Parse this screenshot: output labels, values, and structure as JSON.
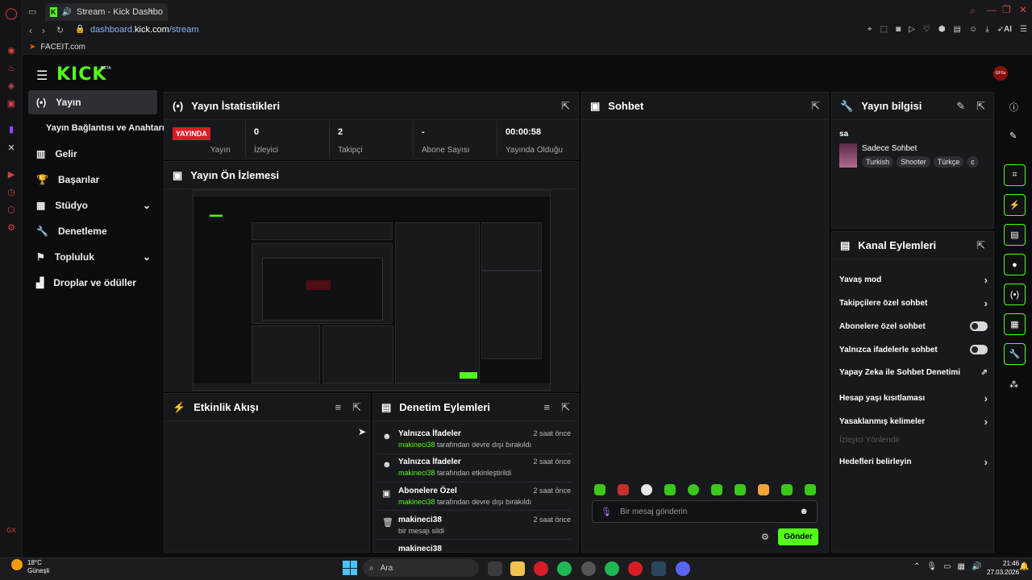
{
  "browser": {
    "tab_title": "Stream - Kick Dashbo",
    "url_host": "dashboard.",
    "url_domain": "kick.com",
    "url_path": "/stream",
    "bookmark": "FACEIT.com",
    "ai_label": "AI"
  },
  "header": {
    "logo": "KICK",
    "beta": "BETA",
    "avatar": "GFSs"
  },
  "sidebar": {
    "items": [
      {
        "label": "Yayın",
        "icon": "broadcast-icon"
      },
      {
        "label": "Yayın Bağlantısı ve Anahtarı",
        "icon": ""
      },
      {
        "label": "Gelir",
        "icon": "bar-chart-icon"
      },
      {
        "label": "Başarılar",
        "icon": "trophy-icon"
      },
      {
        "label": "Stüdyo",
        "icon": "studio-icon"
      },
      {
        "label": "Denetleme",
        "icon": "wrench-icon"
      },
      {
        "label": "Topluluk",
        "icon": "community-icon"
      },
      {
        "label": "Droplar ve ödüller",
        "icon": "gift-icon"
      }
    ]
  },
  "stats": {
    "title": "Yayın İstatistikleri",
    "live_badge": "YAYINDA",
    "live_label": "Yayın",
    "items": [
      {
        "value": "0",
        "label": "İzleyici"
      },
      {
        "value": "2",
        "label": "Takipçi"
      },
      {
        "value": "-",
        "label": "Abone Sayısı"
      },
      {
        "value": "00:00:58",
        "label": "Yayında Olduğu"
      }
    ]
  },
  "preview": {
    "title": "Yayın Ön İzlemesi"
  },
  "activity": {
    "title": "Etkinlik Akışı"
  },
  "moderation": {
    "title": "Denetim Eylemleri",
    "items": [
      {
        "title": "Yalnızca İfadeler",
        "user": "makineci38",
        "text": " tarafından devre dışı bırakıldı",
        "time": "2 saat önce"
      },
      {
        "title": "Yalnızca İfadeler",
        "user": "makineci38",
        "text": " tarafından etkinleştirildi",
        "time": "2 saat önce"
      },
      {
        "title": "Abonelere Özel",
        "user": "makineci38",
        "text": " tarafından devre dışı bırakıldı",
        "time": "2 saat önce"
      },
      {
        "title": "makineci38",
        "user": "",
        "text": "bir mesajı sildi",
        "time": "2 saat önce"
      },
      {
        "title": "makineci38",
        "user": "",
        "text": "",
        "time": ""
      }
    ]
  },
  "chat": {
    "title": "Sohbet",
    "placeholder": "Bir mesaj gönderin",
    "send": "Gönder"
  },
  "stream_info": {
    "title": "Yayın bilgisi",
    "stream_title": "sa",
    "category": "Sadece Sohbet",
    "tags": [
      "Turkish",
      "Shooter",
      "Türkçe",
      "c"
    ]
  },
  "channel_actions": {
    "title": "Kanal Eylemleri",
    "items": [
      {
        "label": "Yavaş mod",
        "control": "arrow"
      },
      {
        "label": "Takipçilere özel sohbet",
        "control": "arrow"
      },
      {
        "label": "Abonelere özel sohbet",
        "control": "toggle"
      },
      {
        "label": "Yalnızca ifadelerle sohbet",
        "control": "toggle"
      },
      {
        "label": "Yapay Zeka ile Sohbet Denetimi",
        "control": "external"
      },
      {
        "label": "Hesap yaşı kısıtlaması",
        "control": "arrow"
      },
      {
        "label": "Yasaklanmış kelimeler",
        "control": "arrow"
      },
      {
        "label": "İzleyici Yönlendir",
        "control": "disabled"
      },
      {
        "label": "Hedefleri belirleyin",
        "control": "arrow"
      }
    ]
  },
  "taskbar": {
    "weather_temp": "18°C",
    "weather_desc": "Güneşli",
    "search": "Ara",
    "time": "21:46",
    "date": "27.03.2026"
  },
  "colors": {
    "accent": "#53fc18",
    "live": "#d81d27",
    "panel": "#18191c",
    "background": "#0b0c0e"
  }
}
